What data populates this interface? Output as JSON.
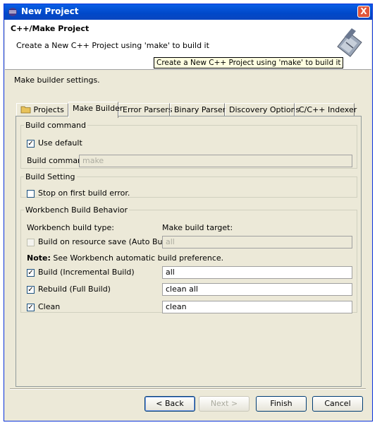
{
  "window": {
    "title": "New Project",
    "close_label": "X"
  },
  "banner": {
    "heading": "C++/Make Project",
    "description": "Create a New C++ Project using 'make' to build it",
    "tooltip": "Create a New C++ Project using 'make' to build it"
  },
  "page": {
    "subtitle": "Make builder settings."
  },
  "tabs": [
    {
      "label": "Projects",
      "icon": "folder-icon"
    },
    {
      "label": "Make Builder",
      "active": true
    },
    {
      "label": "Error Parsers"
    },
    {
      "label": "Binary Parser"
    },
    {
      "label": "Discovery Options"
    },
    {
      "label": "C/C++ Indexer"
    }
  ],
  "build_command": {
    "legend": "Build command",
    "use_default_label": "Use default",
    "use_default_checked": true,
    "command_label": "Build command:",
    "command_value": "make"
  },
  "build_setting": {
    "legend": "Build Setting",
    "stop_label": "Stop on first build error.",
    "stop_checked": false
  },
  "workbench": {
    "legend": "Workbench Build Behavior",
    "type_header": "Workbench build type:",
    "target_header": "Make build target:",
    "note_bold": "Note:",
    "note_text": " See Workbench automatic build preference.",
    "rows": [
      {
        "label": "Build on resource save (Auto Build)",
        "checked": false,
        "enabled": false,
        "target": "all"
      },
      {
        "label": "Build (Incremental Build)",
        "checked": true,
        "enabled": true,
        "target": "all"
      },
      {
        "label": "Rebuild (Full Build)",
        "checked": true,
        "enabled": true,
        "target": "clean all"
      },
      {
        "label": "Clean",
        "checked": true,
        "enabled": true,
        "target": "clean"
      }
    ]
  },
  "buttons": {
    "back": "< Back",
    "next": "Next >",
    "finish": "Finish",
    "cancel": "Cancel"
  }
}
